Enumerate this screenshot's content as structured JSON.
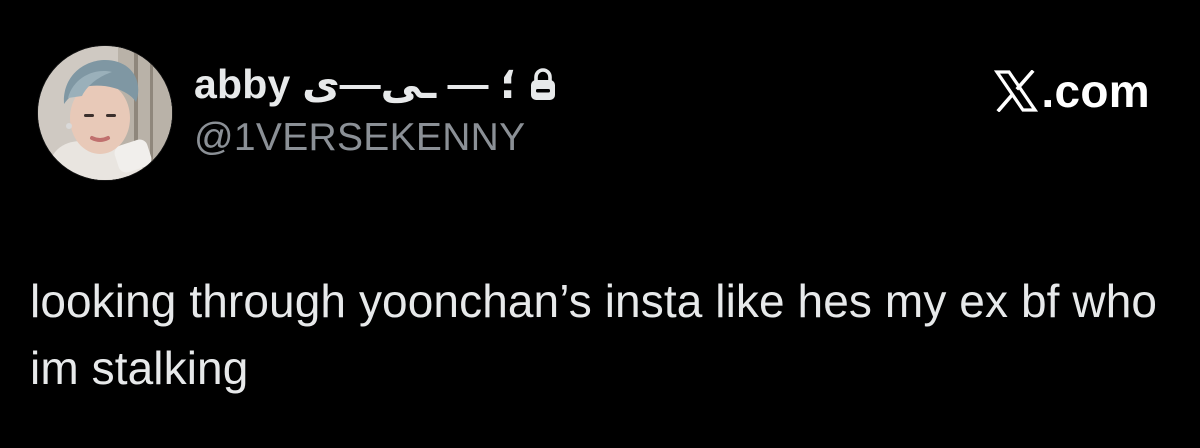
{
  "post": {
    "author": {
      "display_name": "abby ؛ — ـى—ى",
      "handle": "@1VERSEKENNY",
      "avatar": "avatar-photo",
      "protected_icon": "lock-icon"
    },
    "site": {
      "logo_icon": "x-logo-icon",
      "domain": ".com"
    },
    "text": "looking through yoonchan’s insta like hes my ex bf who im stalking"
  },
  "colors": {
    "background": "#000000",
    "primary_text": "#e7e9ea",
    "secondary_text": "#8b9096"
  }
}
